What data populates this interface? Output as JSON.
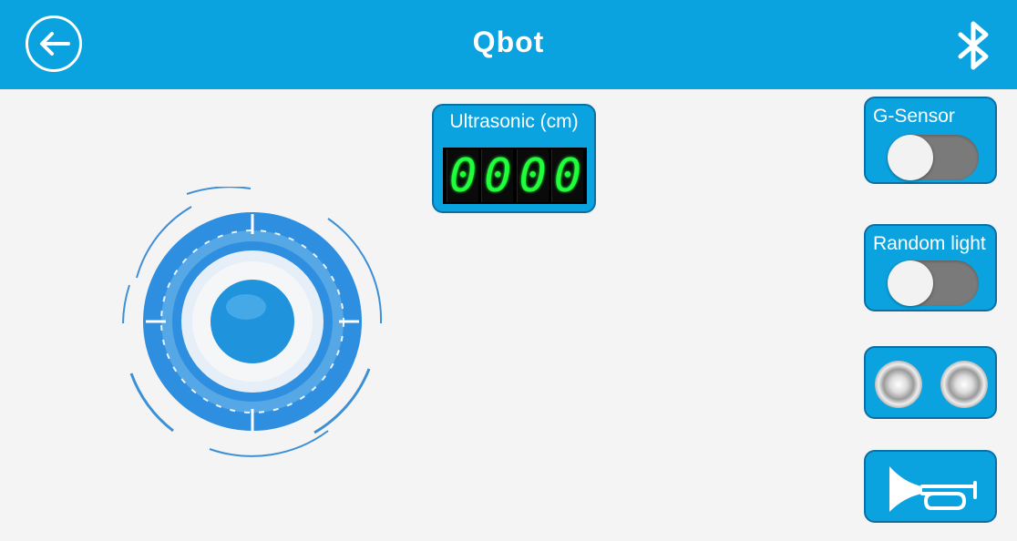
{
  "app": {
    "title": "Qbot",
    "back_icon": "arrow-left-icon",
    "bluetooth_icon": "bluetooth-icon",
    "accent_color": "#0aa3e0"
  },
  "ultrasonic": {
    "label": "Ultrasonic (cm)",
    "digits": [
      "0",
      "0",
      "0",
      "0"
    ],
    "digit_color": "#1fff3a"
  },
  "controls": {
    "gsensor": {
      "label": "G-Sensor",
      "enabled": false
    },
    "random_light": {
      "label": "Random light",
      "enabled": false
    },
    "lights_icon": "headlights-icon",
    "horn_icon": "horn-icon"
  },
  "joystick": {
    "icon": "joystick-icon"
  }
}
